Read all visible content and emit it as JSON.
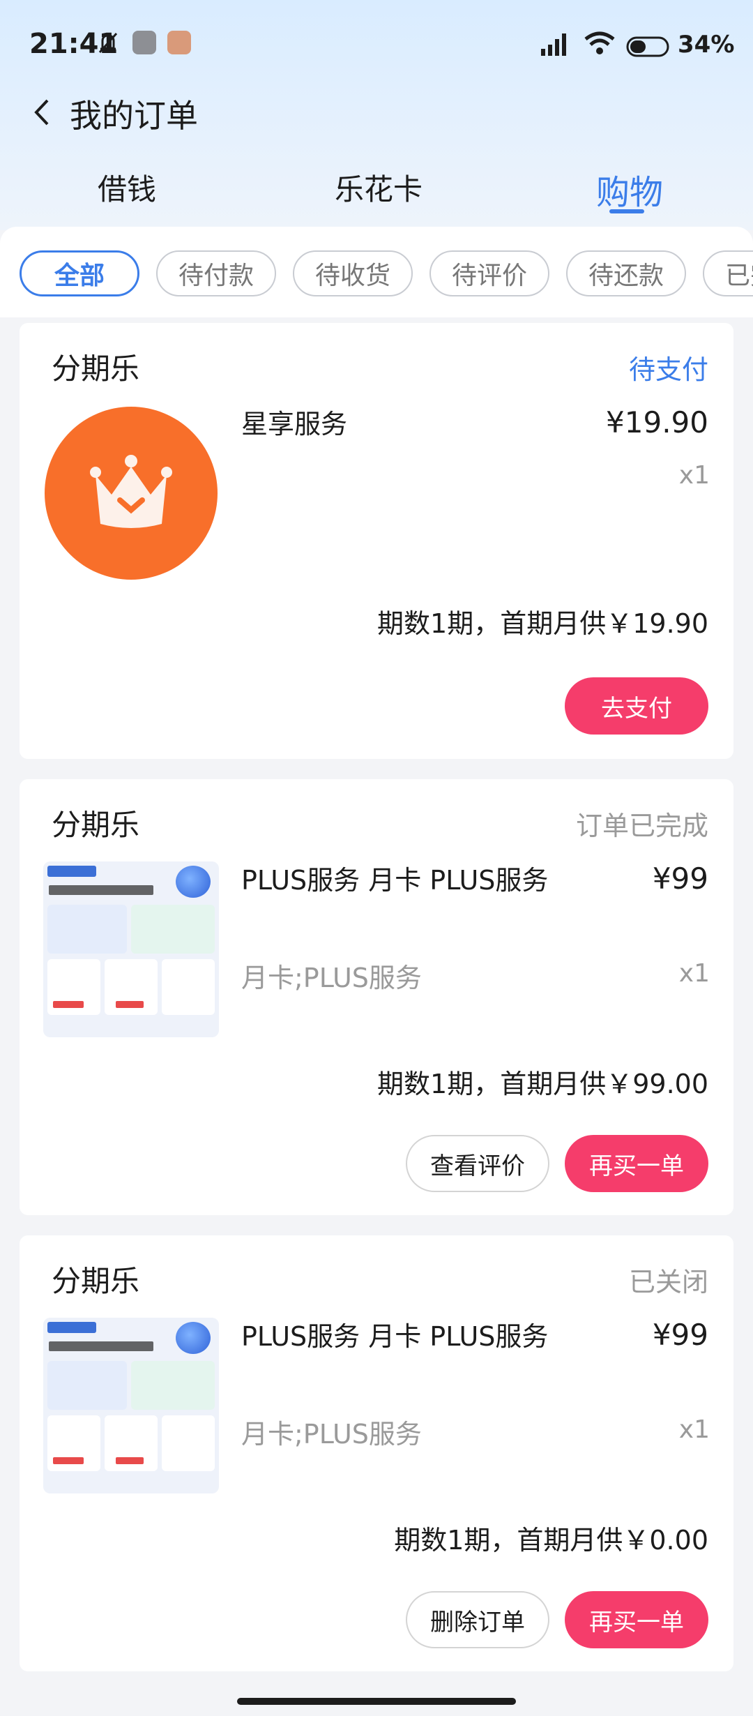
{
  "status_bar": {
    "time": "21:41",
    "battery": "34%"
  },
  "header": {
    "title": "我的订单"
  },
  "main_tabs": [
    {
      "label": "借钱"
    },
    {
      "label": "乐花卡"
    },
    {
      "label": "购物"
    }
  ],
  "filter_chips": [
    {
      "label": "全部"
    },
    {
      "label": "待付款"
    },
    {
      "label": "待收货"
    },
    {
      "label": "待评价"
    },
    {
      "label": "待还款"
    },
    {
      "label": "已完成"
    }
  ],
  "orders": [
    {
      "store": "分期乐",
      "status": "待支付",
      "product_name": "星享服务",
      "price": "¥19.90",
      "quantity": "x1",
      "spec": "",
      "installment": "期数1期，首期月供￥19.90",
      "buttons": [
        "去支付"
      ]
    },
    {
      "store": "分期乐",
      "status": "订单已完成",
      "product_name": "PLUS服务 月卡 PLUS服务",
      "price": "¥99",
      "quantity": "x1",
      "spec": "月卡;PLUS服务",
      "installment": "期数1期，首期月供￥99.00",
      "buttons": [
        "查看评价",
        "再买一单"
      ]
    },
    {
      "store": "分期乐",
      "status": "已关闭",
      "product_name": "PLUS服务 月卡 PLUS服务",
      "price": "¥99",
      "quantity": "x1",
      "spec": "月卡;PLUS服务",
      "installment": "期数1期，首期月供￥0.00",
      "buttons": [
        "删除订单",
        "再买一单"
      ]
    }
  ],
  "colors": {
    "accent": "#3b7de9",
    "primary_button": "#f53d6b",
    "thumb_orange": "#f86f2a"
  }
}
